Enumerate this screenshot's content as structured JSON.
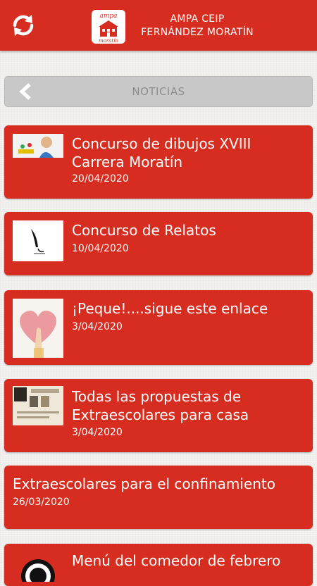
{
  "header": {
    "title_line1": "AMPA CEIP",
    "title_line2": "FERNÁNDEZ MORATÍN",
    "logo_text_top": "ampa",
    "logo_text_bottom": "moratín",
    "refresh_icon": "refresh-icon"
  },
  "section": {
    "title": "NOTICIAS",
    "back_icon": "chevron-left-icon"
  },
  "news": [
    {
      "title": "Concurso de dibujos XVIII Carrera Moratín",
      "date": "20/04/2020",
      "thumb": "child-painting-photo"
    },
    {
      "title": "Concurso de Relatos",
      "date": "10/04/2020",
      "thumb": "quill-pen-icon"
    },
    {
      "title": "¡Peque!....sigue este enlace",
      "date": "3/04/2020",
      "thumb": "heart-hand-painting"
    },
    {
      "title": "Todas las propuestas de Extraescolares para casa",
      "date": "3/04/2020",
      "thumb": "poster-image"
    },
    {
      "title": "Extraescolares para el confinamiento",
      "date": "26/03/2020",
      "thumb": ""
    },
    {
      "title": "Menú del comedor de febrero",
      "date": "",
      "thumb": "round-logo-image"
    }
  ],
  "colors": {
    "primary": "#d72d20",
    "section_bar": "#c8c8c8",
    "background": "#efeeec"
  }
}
